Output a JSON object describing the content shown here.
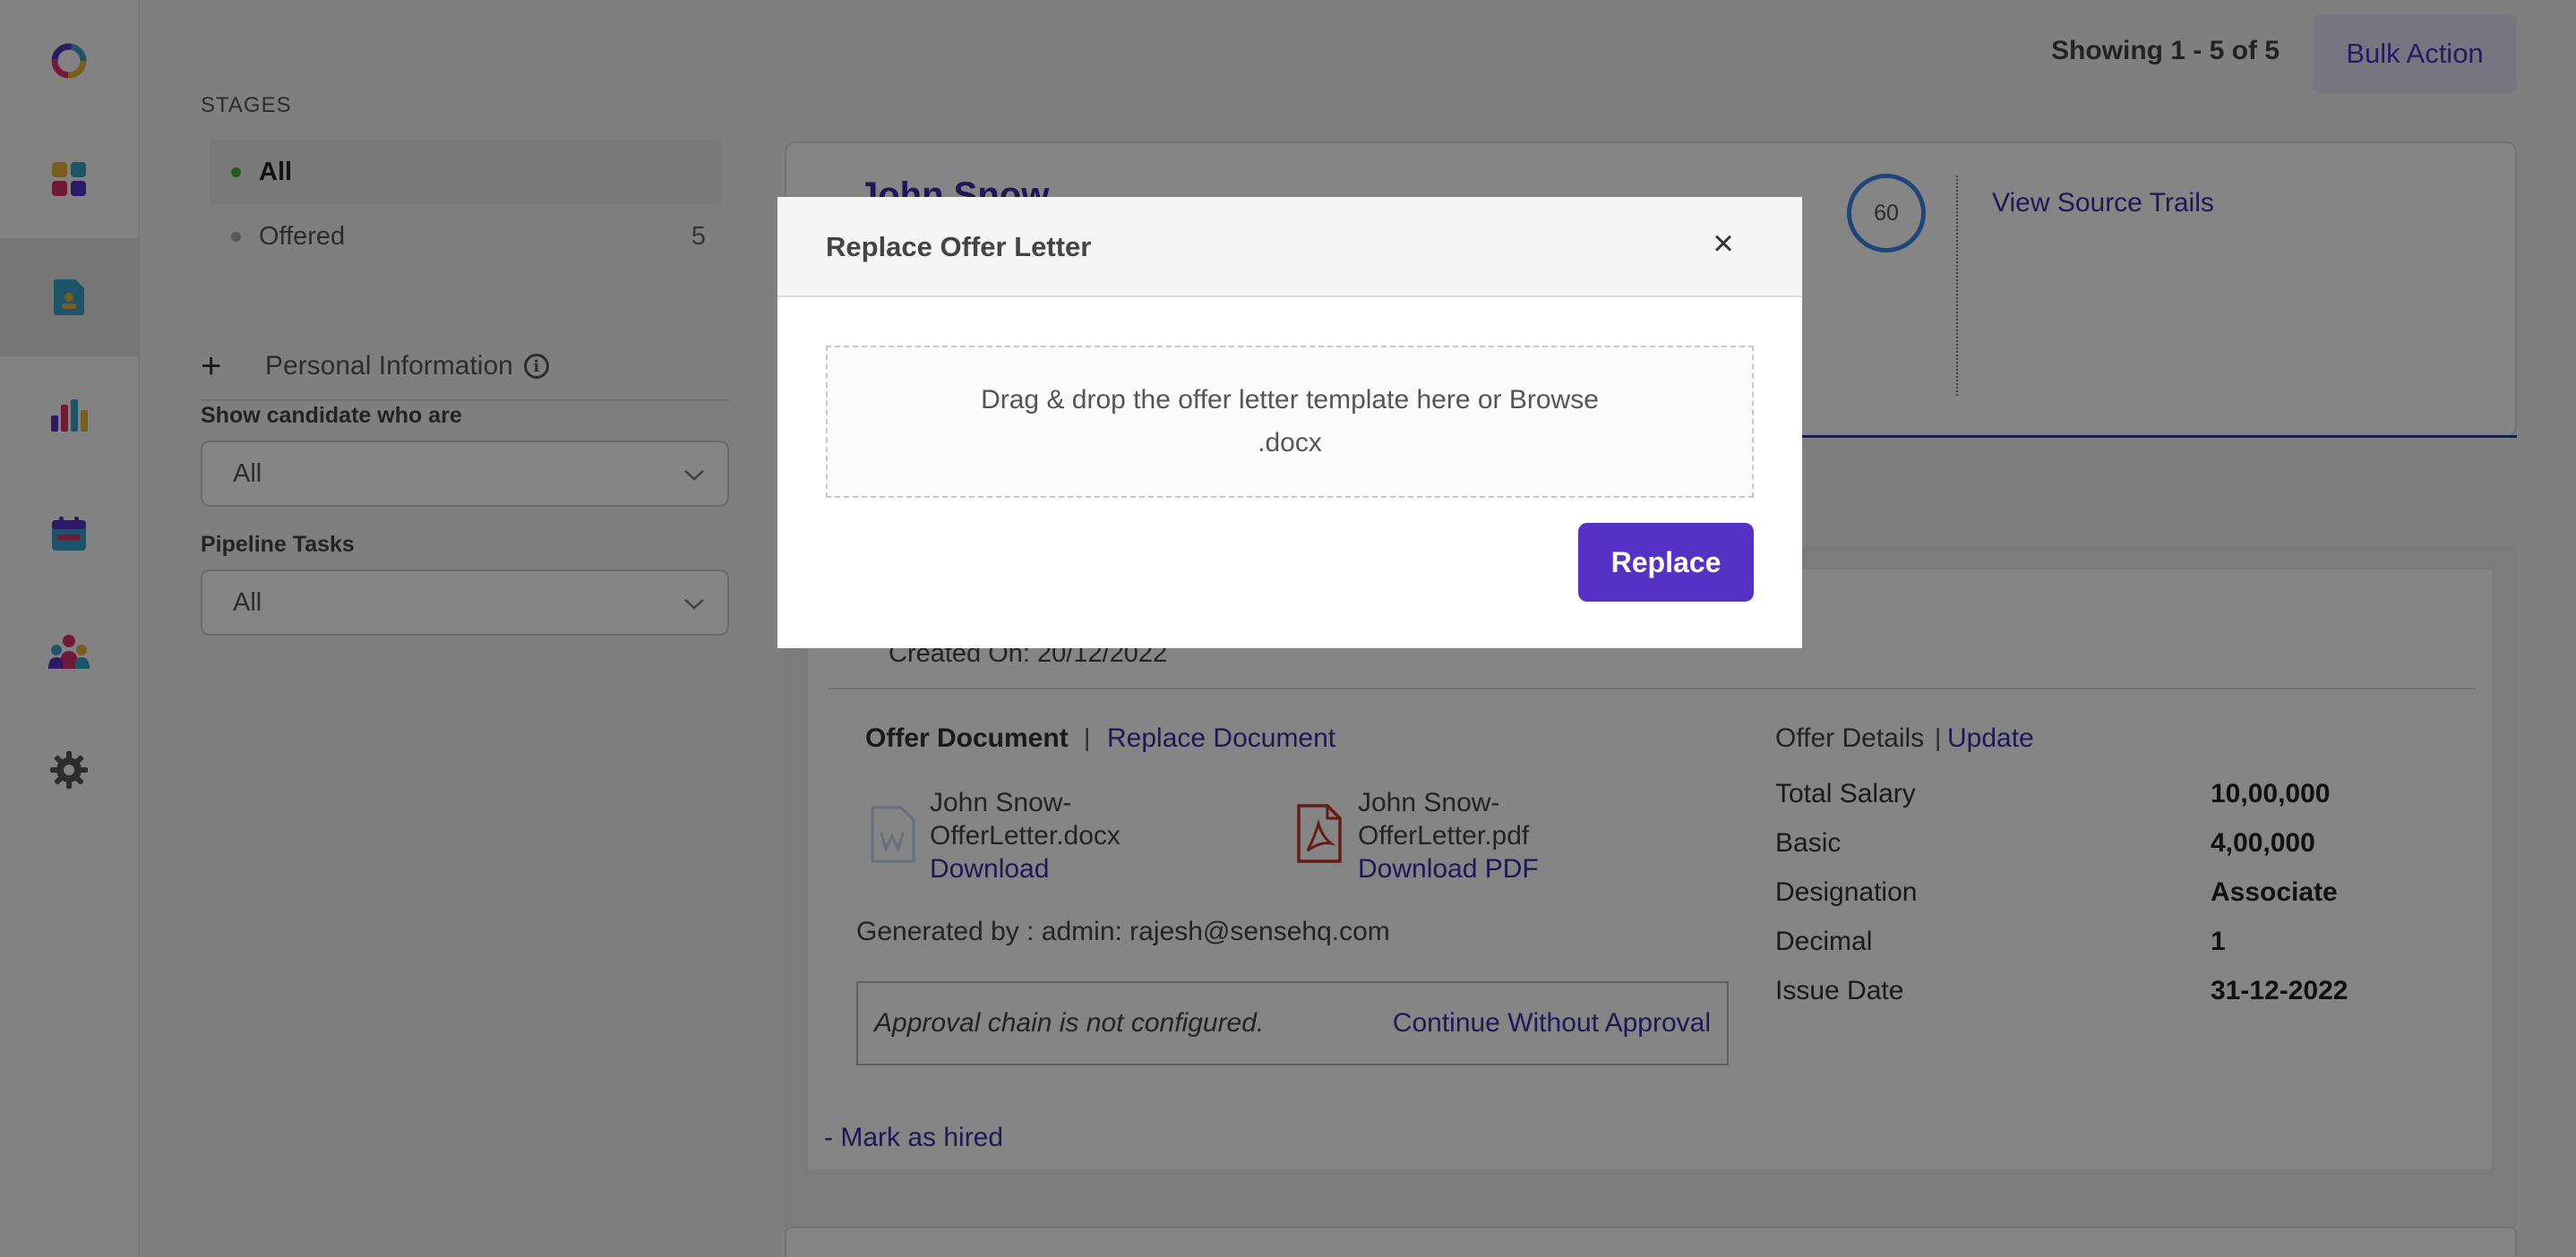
{
  "header": {
    "showing": "Showing 1 - 5 of 5",
    "bulk_action": "Bulk Action"
  },
  "nav": {
    "items": [
      "logo-icon",
      "dashboard-icon",
      "candidates-icon",
      "reports-icon",
      "calendar-icon",
      "team-icon",
      "settings-icon"
    ],
    "active": "candidates-icon"
  },
  "filters": {
    "stages_heading": "STAGES",
    "stages": [
      {
        "label": "All",
        "count": "",
        "dot_color": "#3fae3f"
      },
      {
        "label": "Offered",
        "count": "5",
        "dot_color": "#aaaaaa"
      }
    ],
    "personal_information": "Personal Information",
    "show_candidate_label": "Show candidate who are",
    "show_candidate_value": "All",
    "pipeline_tasks_label": "Pipeline Tasks",
    "pipeline_tasks_value": "All"
  },
  "candidate": {
    "name": "John Snow",
    "score": "60",
    "view_source_trails": "View Source Trails"
  },
  "offer": {
    "created_on": "Created On: 20/12/2022",
    "document_title": "Offer Document",
    "separator": "|",
    "replace_document": "Replace Document",
    "docx_name_line1": "John Snow-",
    "docx_name_line2": "OfferLetter.docx",
    "docx_download": "Download",
    "pdf_name_line1": "John Snow-",
    "pdf_name_line2": "OfferLetter.pdf",
    "pdf_download": "Download PDF",
    "generated_by": "Generated by :  admin: rajesh@sensehq.com",
    "approval_message": "Approval chain is not configured.",
    "continue_without_approval": "Continue Without Approval",
    "mark_as_hired": "- Mark as hired",
    "details_title": "Offer Details",
    "details_separator": "|",
    "update": "Update",
    "details": [
      {
        "key": "Total Salary",
        "value": "10,00,000"
      },
      {
        "key": "Basic",
        "value": "4,00,000"
      },
      {
        "key": "Designation",
        "value": "Associate"
      },
      {
        "key": "Decimal",
        "value": "1"
      },
      {
        "key": "Issue Date",
        "value": "31-12-2022"
      }
    ]
  },
  "modal": {
    "title": "Replace Offer Letter",
    "close_symbol": "×",
    "dropzone_text": "Drag & drop the offer letter template here or Browse",
    "dropzone_format": ".docx",
    "replace_button": "Replace"
  },
  "colors": {
    "accent": "#5531c5",
    "link": "#3d2ea8",
    "overlay": "rgba(0,0,0,0.48)"
  }
}
